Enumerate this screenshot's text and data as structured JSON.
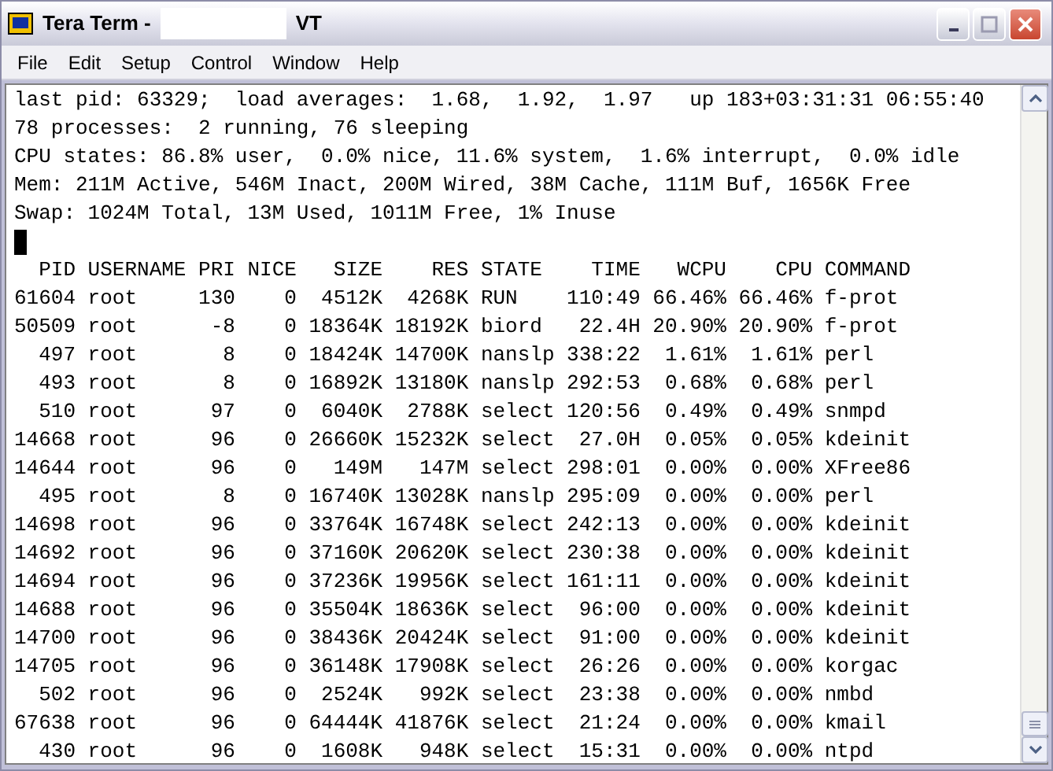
{
  "window": {
    "title": "Tera Term -",
    "title_suffix": "VT"
  },
  "menu": [
    {
      "label": "File"
    },
    {
      "label": "Edit"
    },
    {
      "label": "Setup"
    },
    {
      "label": "Control"
    },
    {
      "label": "Window"
    },
    {
      "label": "Help"
    }
  ],
  "terminal": {
    "lines": [
      {
        "kind": "text",
        "text": "last pid: 63329;  load averages:  1.68,  1.92,  1.97   up 183+03:31:31 06:55:40"
      },
      {
        "kind": "text",
        "text": "78 processes:  2 running, 76 sleeping"
      },
      {
        "kind": "text",
        "text": "CPU states: 86.8% user,  0.0% nice, 11.6% system,  1.6% interrupt,  0.0% idle"
      },
      {
        "kind": "text",
        "text": "Mem: 211M Active, 546M Inact, 200M Wired, 38M Cache, 111M Buf, 1656K Free"
      },
      {
        "kind": "text",
        "text": "Swap: 1024M Total, 13M Used, 1011M Free, 1% Inuse"
      },
      {
        "kind": "cursor"
      },
      {
        "kind": "text",
        "text": "  PID USERNAME PRI NICE   SIZE    RES STATE    TIME   WCPU    CPU COMMAND"
      },
      {
        "kind": "text",
        "text": "61604 root     130    0  4512K  4268K RUN    110:49 66.46% 66.46% f-prot"
      },
      {
        "kind": "text",
        "text": "50509 root      -8    0 18364K 18192K biord   22.4H 20.90% 20.90% f-prot"
      },
      {
        "kind": "text",
        "text": "  497 root       8    0 18424K 14700K nanslp 338:22  1.61%  1.61% perl"
      },
      {
        "kind": "text",
        "text": "  493 root       8    0 16892K 13180K nanslp 292:53  0.68%  0.68% perl"
      },
      {
        "kind": "text",
        "text": "  510 root      97    0  6040K  2788K select 120:56  0.49%  0.49% snmpd"
      },
      {
        "kind": "text",
        "text": "14668 root      96    0 26660K 15232K select  27.0H  0.05%  0.05% kdeinit"
      },
      {
        "kind": "text",
        "text": "14644 root      96    0   149M   147M select 298:01  0.00%  0.00% XFree86"
      },
      {
        "kind": "text",
        "text": "  495 root       8    0 16740K 13028K nanslp 295:09  0.00%  0.00% perl"
      },
      {
        "kind": "text",
        "text": "14698 root      96    0 33764K 16748K select 242:13  0.00%  0.00% kdeinit"
      },
      {
        "kind": "text",
        "text": "14692 root      96    0 37160K 20620K select 230:38  0.00%  0.00% kdeinit"
      },
      {
        "kind": "text",
        "text": "14694 root      96    0 37236K 19956K select 161:11  0.00%  0.00% kdeinit"
      },
      {
        "kind": "text",
        "text": "14688 root      96    0 35504K 18636K select  96:00  0.00%  0.00% kdeinit"
      },
      {
        "kind": "text",
        "text": "14700 root      96    0 38436K 20424K select  91:00  0.00%  0.00% kdeinit"
      },
      {
        "kind": "text",
        "text": "14705 root      96    0 36148K 17908K select  26:26  0.00%  0.00% korgac"
      },
      {
        "kind": "text",
        "text": "  502 root      96    0  2524K   992K select  23:38  0.00%  0.00% nmbd"
      },
      {
        "kind": "text",
        "text": "67638 root      96    0 64444K 41876K select  21:24  0.00%  0.00% kmail"
      },
      {
        "kind": "text",
        "text": "  430 root      96    0  1608K   948K select  15:31  0.00%  0.00% ntpd"
      }
    ]
  }
}
